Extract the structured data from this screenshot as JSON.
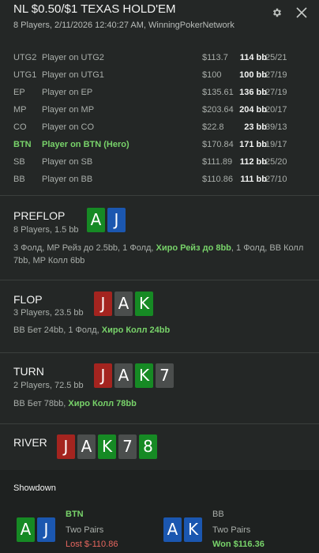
{
  "header": {
    "title": "NL $0.50/$1 TEXAS HOLD'EM",
    "subtitle": "8 Players, 2/11/2026 12:40:27 AM, WinningPokerNetwork",
    "settings_icon": "gear-icon",
    "close_icon": "close-icon"
  },
  "players": [
    {
      "pos": "UTG2",
      "name": "Player on UTG2",
      "stack": "$113.7",
      "bb": "114 bb",
      "vp": "25/21"
    },
    {
      "pos": "UTG1",
      "name": "Player on UTG1",
      "stack": "$100",
      "bb": "100 bb",
      "vp": "27/19"
    },
    {
      "pos": "EP",
      "name": "Player on EP",
      "stack": "$135.61",
      "bb": "136 bb",
      "vp": "27/19"
    },
    {
      "pos": "MP",
      "name": "Player on MP",
      "stack": "$203.64",
      "bb": "204 bb",
      "vp": "20/17"
    },
    {
      "pos": "CO",
      "name": "Player on CO",
      "stack": "$22.8",
      "bb": "23 bb",
      "vp": "39/13"
    },
    {
      "pos": "BTN",
      "name": "Player on BTN (Hero)",
      "stack": "$170.84",
      "bb": "171 bb",
      "vp": "19/17"
    },
    {
      "pos": "SB",
      "name": "Player on SB",
      "stack": "$111.89",
      "bb": "112 bb",
      "vp": "25/20"
    },
    {
      "pos": "BB",
      "name": "Player on BB",
      "stack": "$110.86",
      "bb": "111 bb",
      "vp": "27/10"
    }
  ],
  "preflop": {
    "name": "PREFLOP",
    "info": "8 Players, 1.5 bb",
    "cards": [
      "A",
      "J"
    ],
    "actions_a": "3 Фолд, MP Рейз до 2.5bb, 1 Фолд, ",
    "actions_hero": "Хиро Рейз до 8bb",
    "actions_b": ", 1 Фолд, BB Колл 7bb, MP Колл 6bb"
  },
  "flop": {
    "name": "FLOP",
    "info": "3 Players, 23.5 bb",
    "cards": [
      "J",
      "A",
      "K"
    ],
    "actions_a": "BB Бет 24bb, 1 Фолд, ",
    "actions_hero": "Хиро Колл 24bb"
  },
  "turn": {
    "name": "TURN",
    "info": "2 Players, 72.5 bb",
    "cards": [
      "J",
      "A",
      "K",
      "7"
    ],
    "actions_a": "BB Бет 78bb, ",
    "actions_hero": "Хиро Колл 78bb"
  },
  "river": {
    "name": "RIVER",
    "cards": [
      "J",
      "A",
      "K",
      "7",
      "8"
    ]
  },
  "showdown": {
    "title": "Showdown",
    "hero": {
      "pos": "BTN",
      "cards": [
        "A",
        "J"
      ],
      "hand": "Two Pairs",
      "result": "Lost $-110.86"
    },
    "villain": {
      "pos": "BB",
      "cards": [
        "A",
        "K"
      ],
      "hand": "Two Pairs",
      "result": "Won $116.36"
    }
  },
  "colors": {
    "background": "#242726",
    "hero_green": "#78d36a",
    "lost_red": "#e8675f",
    "card_red": "#a4241f",
    "card_green": "#168a24",
    "card_blue": "#1b57b0",
    "card_gray": "#4b4e4d"
  }
}
